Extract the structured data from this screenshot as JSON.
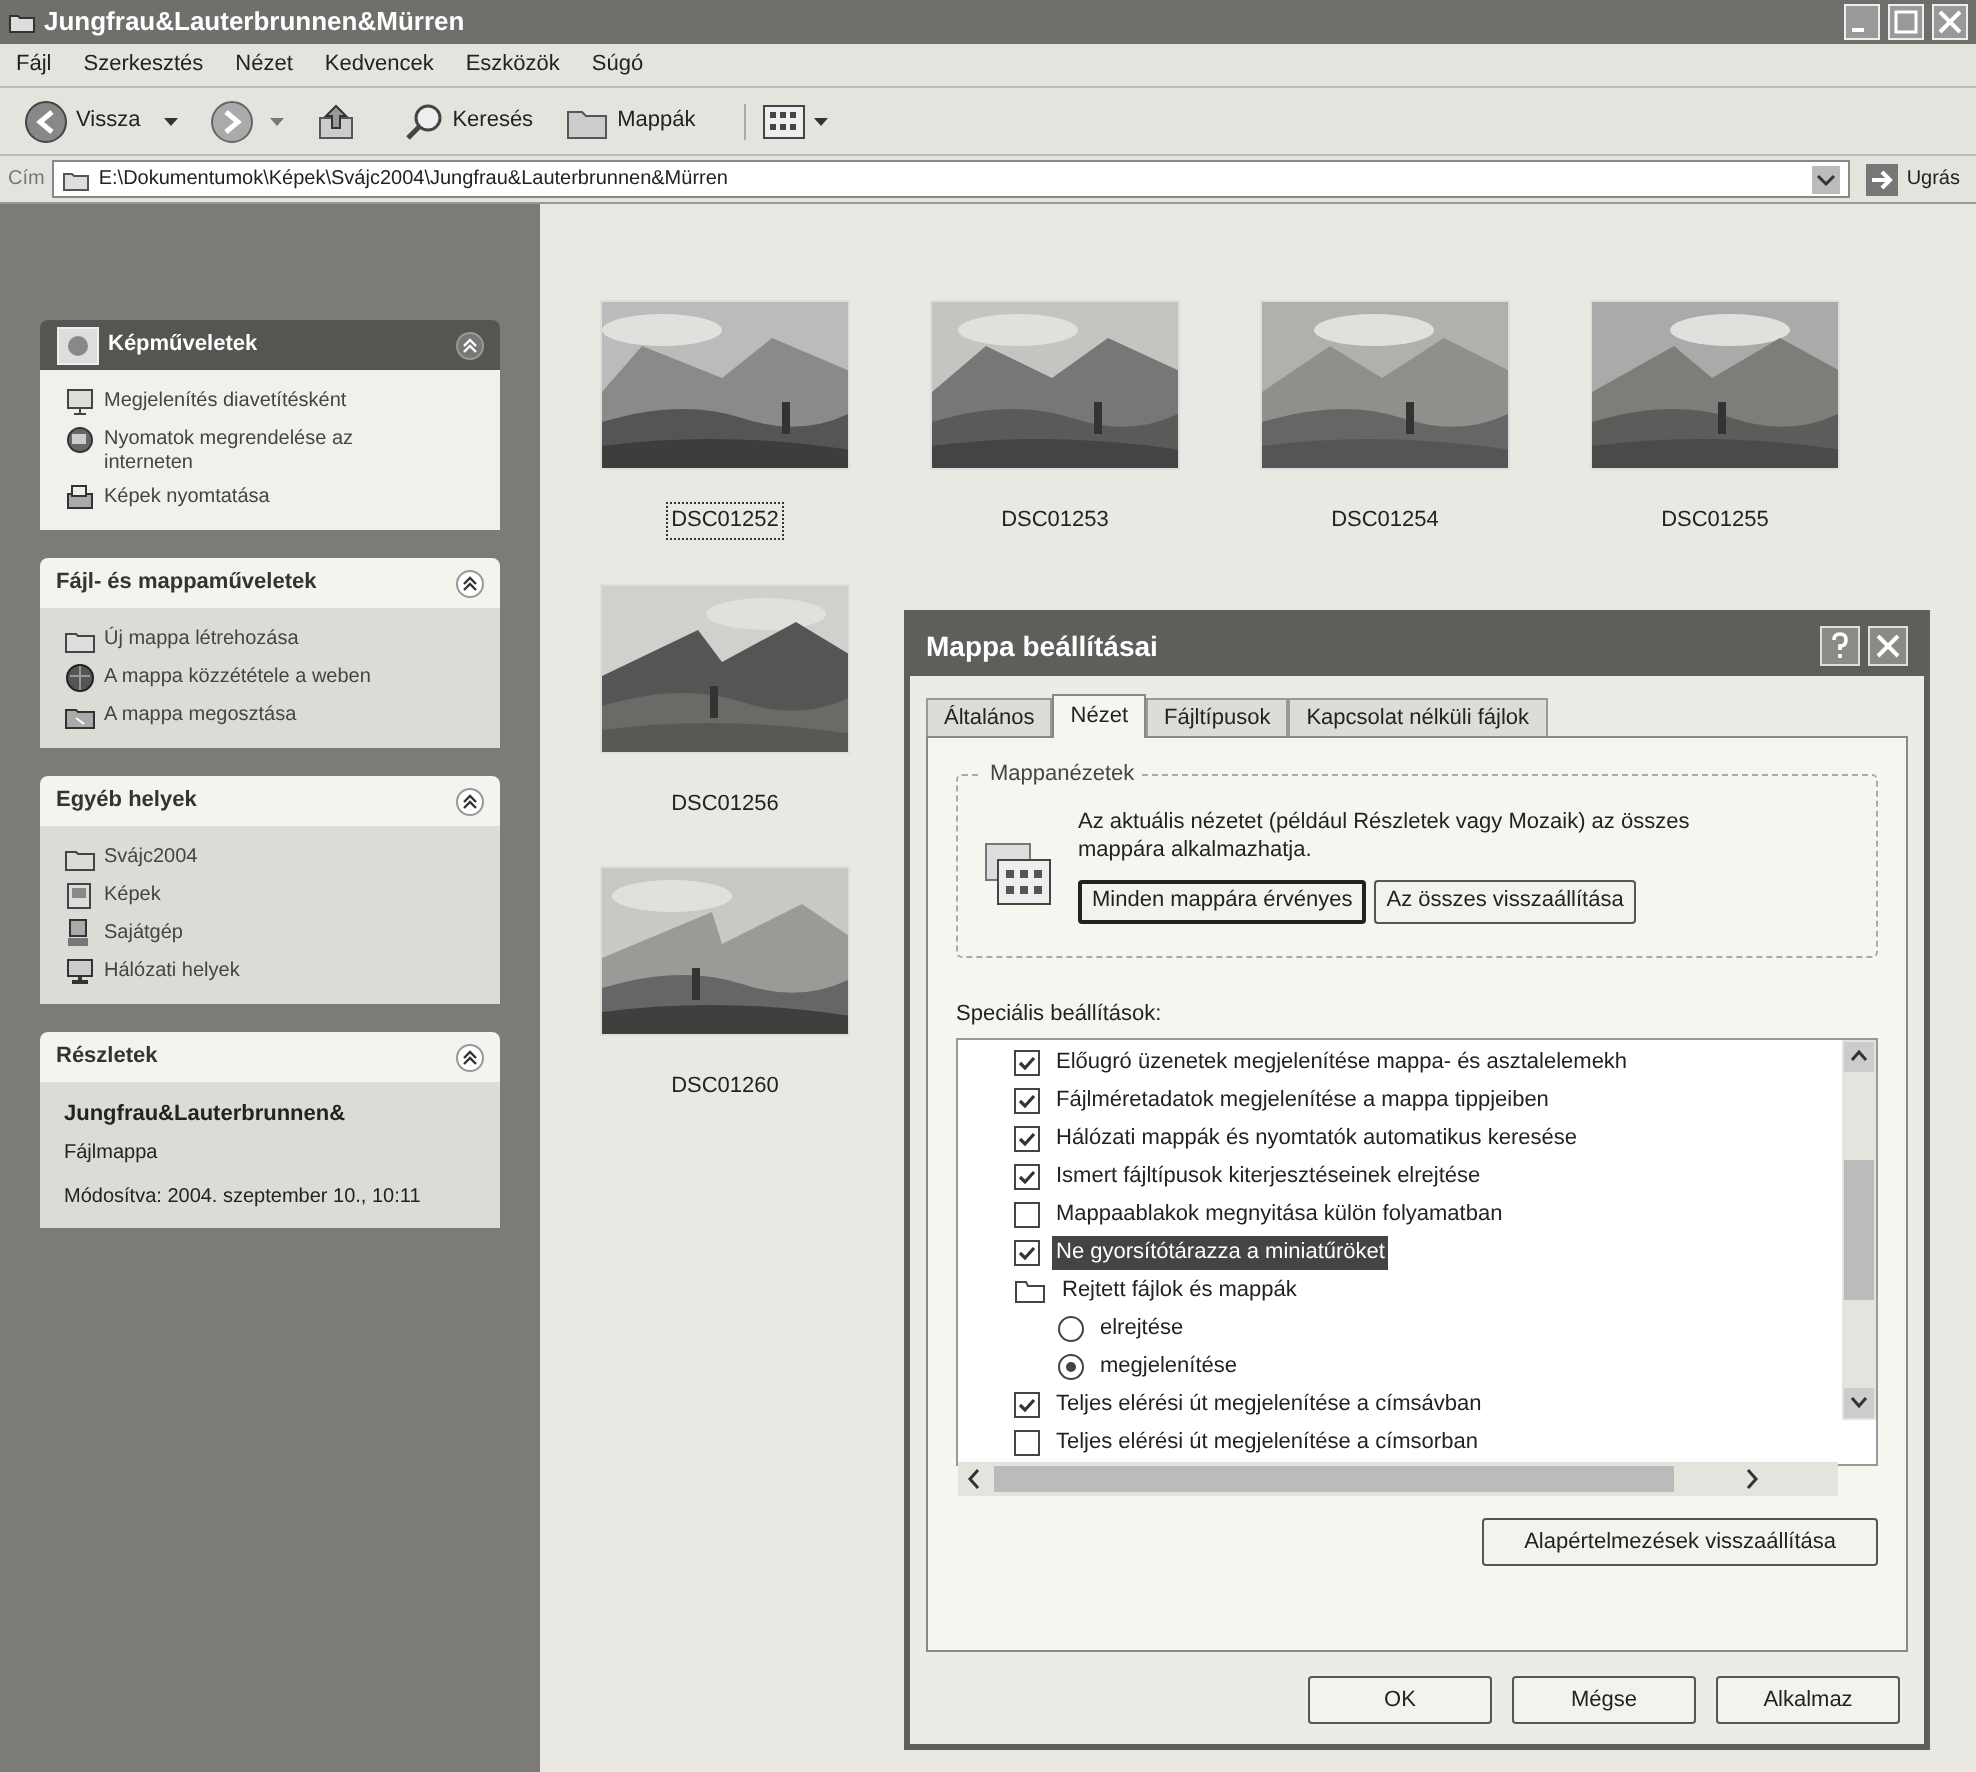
{
  "window": {
    "title": "Jungfrau&Lauterbrunnen&Mürren"
  },
  "menu": [
    "Fájl",
    "Szerkesztés",
    "Nézet",
    "Kedvencek",
    "Eszközök",
    "Súgó"
  ],
  "toolbar": {
    "back": "Vissza",
    "search": "Keresés",
    "folders": "Mappák"
  },
  "address": {
    "label": "Cím",
    "value": "E:\\Dokumentumok\\Képek\\Svájc2004\\Jungfrau&Lauterbrunnen&Mürren",
    "go": "Ugrás"
  },
  "sidebar": [
    {
      "kind": "featured",
      "title": "Képműveletek",
      "items": [
        "Megjelenítés diavetítésként",
        "Nyomatok megrendelése az interneten",
        "Képek nyomtatása"
      ]
    },
    {
      "kind": "tasks",
      "title": "Fájl- és mappaműveletek",
      "items": [
        "Új mappa létrehozása",
        "A mappa közzététele a weben",
        "A mappa megosztása"
      ]
    },
    {
      "kind": "places",
      "title": "Egyéb helyek",
      "items": [
        "Svájc2004",
        "Képek",
        "Sajátgép",
        "Hálózati helyek"
      ]
    },
    {
      "kind": "details",
      "title": "Részletek",
      "name": "Jungfrau&Lauterbrunnen&",
      "type": "Fájlmappa",
      "modified": "Módosítva: 2004. szeptember 10., 10:11"
    }
  ],
  "files": [
    {
      "name": "DSC01252",
      "selected": true,
      "kind": "picture"
    },
    {
      "name": "DSC01253",
      "selected": false,
      "kind": "picture"
    },
    {
      "name": "DSC01254",
      "selected": false,
      "kind": "picture"
    },
    {
      "name": "DSC01255",
      "selected": false,
      "kind": "picture"
    },
    {
      "name": "DSC01256",
      "selected": false,
      "kind": "picture"
    },
    {
      "name": "DSC01260",
      "selected": false,
      "kind": "picture"
    }
  ],
  "dialog": {
    "title": "Mappa beállításai",
    "tabs": [
      {
        "label": "Általános",
        "selected": false
      },
      {
        "label": "Nézet",
        "selected": true
      },
      {
        "label": "Fájltípusok",
        "selected": false
      },
      {
        "label": "Kapcsolat nélküli fájlok",
        "selected": false
      }
    ],
    "group": {
      "title": "Mappanézetek",
      "text": "Az aktuális nézetet (például Részletek vagy Mozaik) az összes mappára alkalmazhatja.",
      "buttons": [
        "Minden mappára érvényes",
        "Az összes visszaállítása"
      ]
    },
    "advanced_label": "Speciális beállítások:",
    "settings": [
      {
        "kind": "checkbox",
        "label": "Előugró üzenetek megjelenítése mappa- és asztalelemekh",
        "checked": true,
        "selected": false
      },
      {
        "kind": "checkbox",
        "label": "Fájlméretadatok megjelenítése a mappa tippjeiben",
        "checked": true,
        "selected": false
      },
      {
        "kind": "checkbox",
        "label": "Hálózati mappák és nyomtatók automatikus keresése",
        "checked": true,
        "selected": false
      },
      {
        "kind": "checkbox",
        "label": "Ismert fájltípusok kiterjesztéseinek elrejtése",
        "checked": true,
        "selected": false
      },
      {
        "kind": "checkbox",
        "label": "Mappaablakok megnyitása külön folyamatban",
        "checked": false,
        "selected": false
      },
      {
        "kind": "checkbox",
        "label": "Ne gyorsítótárazza a miniatűröket",
        "checked": true,
        "selected": true
      },
      {
        "kind": "folder",
        "label": "Rejtett fájlok és mappák",
        "selected": false,
        "children": [
          {
            "kind": "radio",
            "label": "elrejtése",
            "checked": false,
            "selected": false
          },
          {
            "kind": "radio",
            "label": "megjelenítése",
            "checked": true,
            "selected": false
          }
        ]
      },
      {
        "kind": "checkbox",
        "label": "Teljes elérési út megjelenítése a címsávban",
        "checked": true,
        "selected": false
      },
      {
        "kind": "checkbox",
        "label": "Teljes elérési út megjelenítése a címsorban",
        "checked": false,
        "selected": false
      }
    ],
    "reset": "Alapértelmezések visszaállítása",
    "buttons": [
      "OK",
      "Mégse",
      "Alkalmaz"
    ]
  }
}
